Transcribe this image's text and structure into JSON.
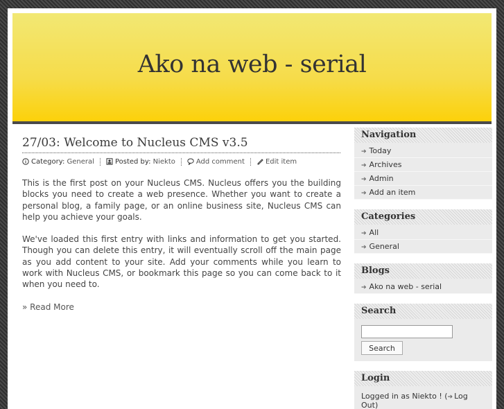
{
  "site": {
    "title": "Ako na web - serial"
  },
  "post": {
    "title": "27/03: Welcome to Nucleus CMS v3.5",
    "meta": {
      "category_label": "Category:",
      "category_value": "General",
      "posted_label": "Posted by:",
      "posted_value": "Niekto",
      "comment_label": "Add comment",
      "edit_label": "Edit item"
    },
    "paragraphs": [
      "This is the first post on your Nucleus CMS. Nucleus offers you the building blocks you need to create a web presence. Whether you want to create a personal blog, a family page, or an online business site, Nucleus CMS can help you achieve your goals.",
      "We've loaded this first entry with links and information to get you started. Though you can delete this entry, it will eventually scroll off the main page as you add content to your site. Add your comments while you learn to work with Nucleus CMS, or bookmark this page so you can come back to it when you need to."
    ],
    "read_more": "» Read More"
  },
  "sidebar": {
    "navigation": {
      "title": "Navigation",
      "items": [
        "Today",
        "Archives",
        "Admin",
        "Add an item"
      ]
    },
    "categories": {
      "title": "Categories",
      "items": [
        "All",
        "General"
      ]
    },
    "blogs": {
      "title": "Blogs",
      "items": [
        "Ako na web - serial"
      ]
    },
    "search": {
      "title": "Search",
      "input_value": "",
      "button_label": "Search"
    },
    "login": {
      "title": "Login",
      "text": "Logged in as Niekto ! (",
      "link": "Log Out",
      "text_end": ")"
    }
  },
  "icons": {
    "arrow": "arrow-right-icon",
    "category": "info-icon",
    "posted": "user-icon",
    "comment": "comment-icon",
    "edit": "pencil-icon"
  }
}
